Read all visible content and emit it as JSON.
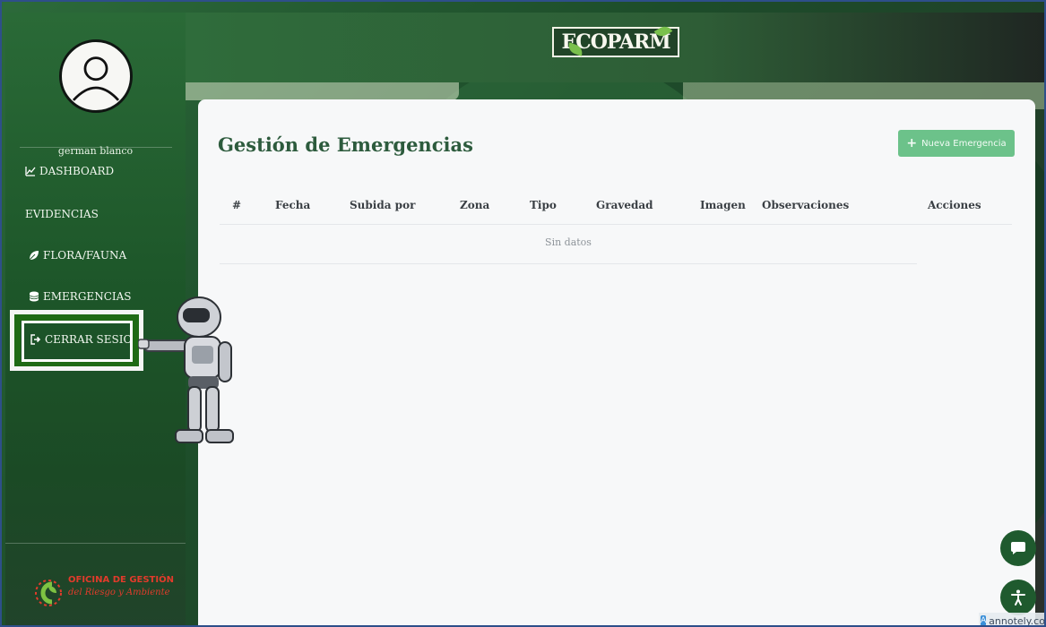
{
  "header": {
    "logo_text": "ECOPARM"
  },
  "sidebar": {
    "username": "german blanco",
    "items": [
      {
        "label": "DASHBOARD",
        "icon": "chart-line-icon"
      },
      {
        "label": "EVIDENCIAS",
        "icon": ""
      },
      {
        "label": "FLORA/FAUNA",
        "icon": "leaf-icon"
      },
      {
        "label": "EMERGENCIAS",
        "icon": "database-icon"
      },
      {
        "label": "CERRAR SESION",
        "icon": "sign-out-icon"
      }
    ],
    "footer": {
      "title": "OFICINA DE GESTIÓN",
      "subtitle": "del Riesgo y Ambiente"
    }
  },
  "main": {
    "title": "Gestión de Emergencias",
    "new_button_label": "Nueva Emergencia",
    "table": {
      "columns": [
        "#",
        "Fecha",
        "Subida por",
        "Zona",
        "Tipo",
        "Gravedad",
        "Imagen",
        "Observaciones",
        "Acciones"
      ],
      "empty_text": "Sin datos"
    }
  },
  "watermark": {
    "text": "annotely.com"
  },
  "colors": {
    "sidebar_green": "#1d5629",
    "title_green": "#2d5b3d",
    "button_green": "#6cc28a",
    "highlight_green": "#1f6a15"
  }
}
